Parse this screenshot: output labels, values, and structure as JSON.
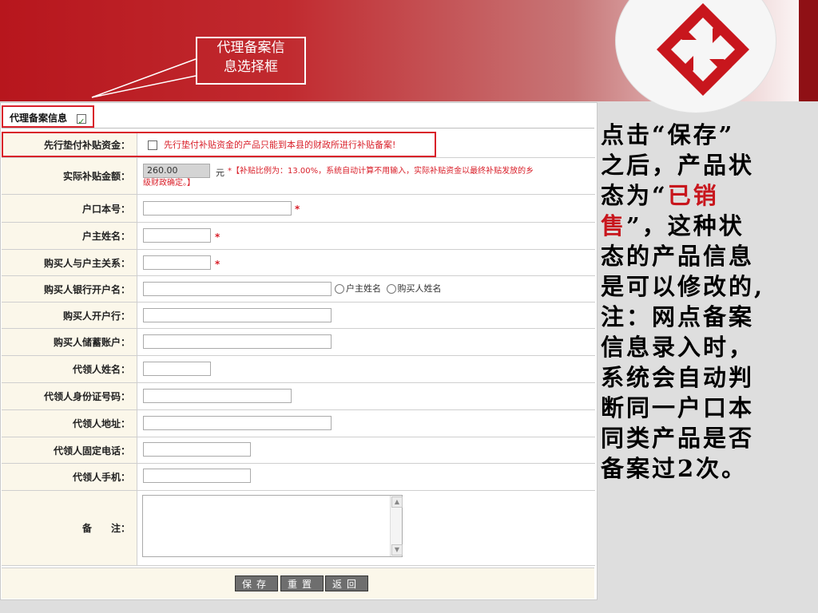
{
  "callout": {
    "line1": "代理备案信",
    "line2": "息选择框"
  },
  "section": {
    "title": "代理备案信息",
    "checked": true
  },
  "rows": {
    "prepay_label": "先行垫付补贴资金：",
    "prepay_text": "先行垫付补贴资金的产品只能到本县的财政所进行补贴备案!",
    "subsidy_label": "实际补贴金额：",
    "subsidy_value": "260.00",
    "subsidy_unit": "元",
    "subsidy_note_1": "*【补贴比例为：13.00%，系统自动计算不用输入，实际补贴资金以最终补贴发放的乡",
    "subsidy_note_2": "级财政确定。】",
    "hukou_label": "户口本号：",
    "huzhu_label": "户主姓名：",
    "relation_label": "购买人与户主关系：",
    "bankname_label": "购买人银行开户名：",
    "radio_1": "户主姓名",
    "radio_2": "购买人姓名",
    "bank_label": "购买人开户行：",
    "account_label": "购买人储蓄账户：",
    "agent_name_label": "代领人姓名：",
    "agent_id_label": "代领人身份证号码：",
    "agent_addr_label": "代领人地址：",
    "agent_phone_label": "代领人固定电话：",
    "agent_mobile_label": "代领人手机：",
    "remark_label": "备　　注：",
    "star": "*"
  },
  "buttons": {
    "save": "保存",
    "reset": "重置",
    "back": "返回"
  },
  "side_note": {
    "line1": "点击“保存”",
    "line2": "之后，产品状",
    "line3a": "态为“",
    "line3b": "已销",
    "line4a": "售",
    "line4b": "”，这种状",
    "line5": "态的产品信息",
    "line6": "是可以修改的,",
    "line7": "注：网点备案",
    "line8": "信息录入时，",
    "line9": "系统会自动判",
    "line10": "断同一户口本",
    "line11": "同类产品是否",
    "line12": "备案过2次。"
  },
  "colors": {
    "brand_red": "#c8161d",
    "label_bg": "#fbf7ea"
  }
}
